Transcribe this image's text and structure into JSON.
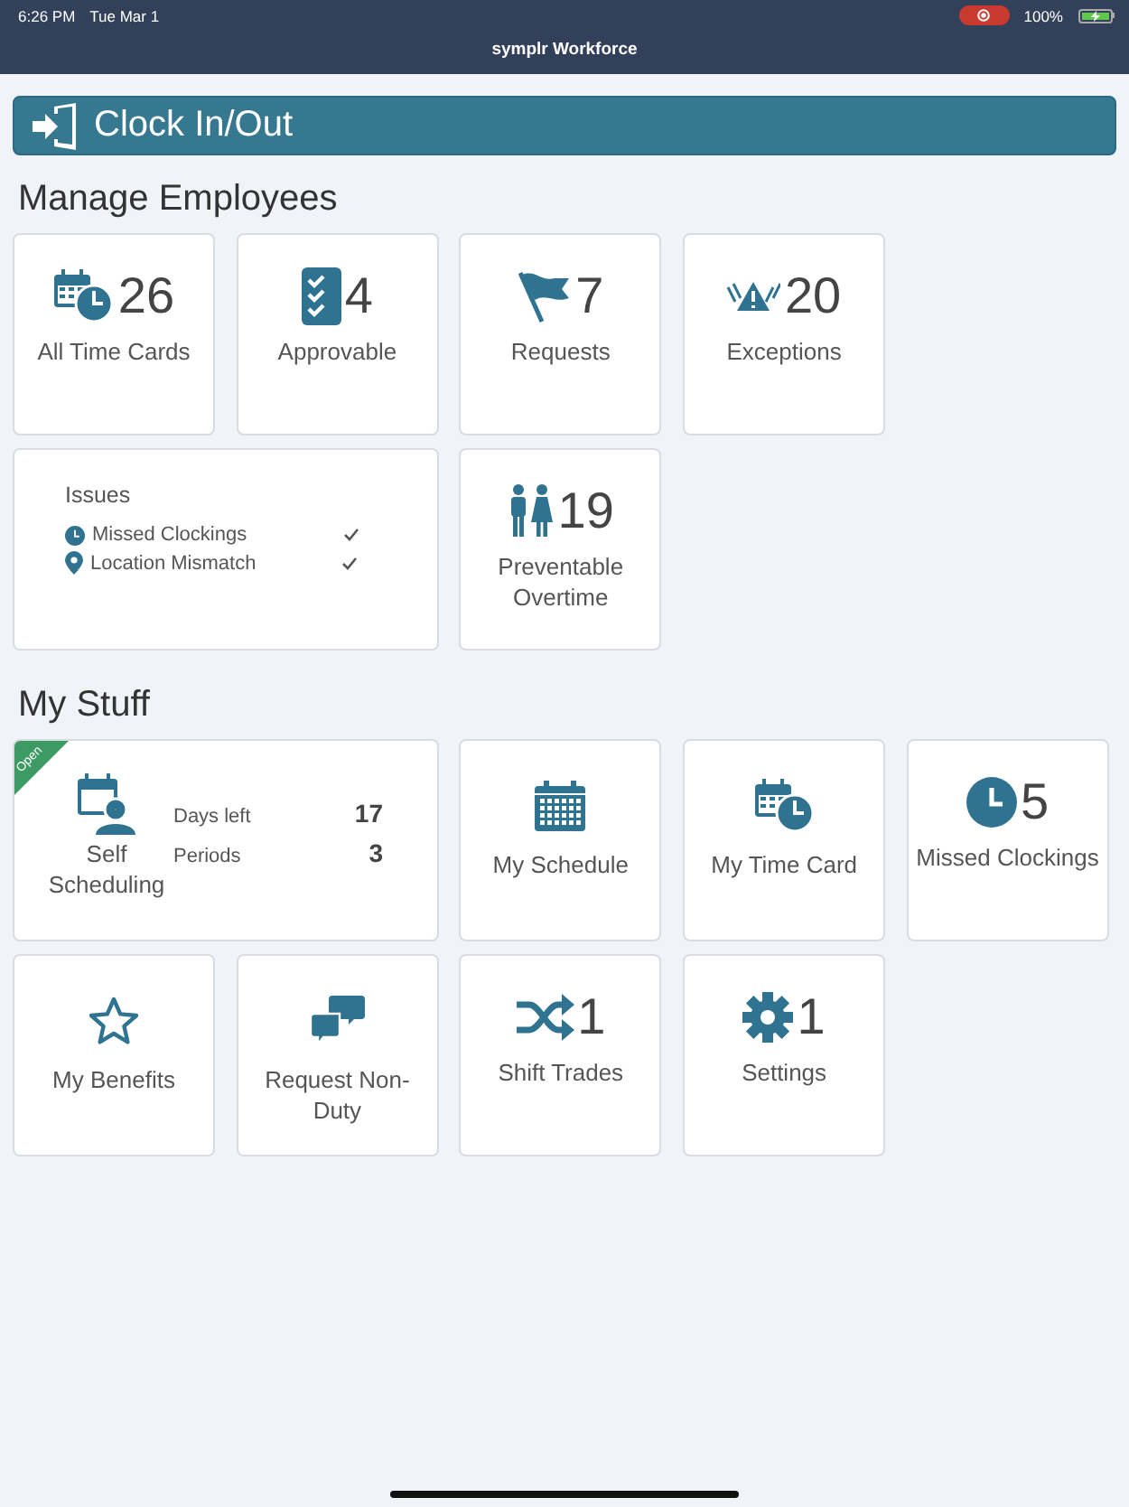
{
  "status_bar": {
    "time": "6:26 PM",
    "date": "Tue Mar 1",
    "recording": true,
    "battery_text": "100%",
    "battery": {
      "charging": true
    }
  },
  "window": {
    "title": "symplr Workforce"
  },
  "clock_button": {
    "label": "Clock In/Out"
  },
  "sections": [
    {
      "title": "Manage Employees",
      "tiles": [
        {
          "kind": "count",
          "count": "26",
          "label": "All Time Cards"
        },
        {
          "kind": "count",
          "count": "4",
          "label": "Approvable"
        },
        {
          "kind": "count",
          "count": "7",
          "label": "Requests"
        },
        {
          "kind": "count",
          "count": "20",
          "label": "Exceptions"
        },
        {
          "kind": "issues",
          "title": "Issues",
          "items": [
            {
              "label": "Missed Clockings",
              "checked": true
            },
            {
              "label": "Location Mismatch",
              "checked": true
            }
          ]
        },
        {
          "kind": "count",
          "count": "19",
          "label": "Preventable Overtime"
        }
      ]
    },
    {
      "title": "My Stuff",
      "tiles": [
        {
          "kind": "self_scheduling",
          "badge": "Open",
          "label": "Self Scheduling",
          "stats": [
            {
              "label": "Days left",
              "value": "17"
            },
            {
              "label": "Periods",
              "value": "3"
            }
          ]
        },
        {
          "kind": "label",
          "label": "My Schedule"
        },
        {
          "kind": "label",
          "label": "My Time Card"
        },
        {
          "kind": "count",
          "count": "5",
          "label": "Missed Clockings"
        },
        {
          "kind": "label",
          "label": "My Benefits"
        },
        {
          "kind": "label",
          "label": "Request Non-Duty"
        },
        {
          "kind": "count",
          "count": "1",
          "label": "Shift Trades"
        },
        {
          "kind": "count",
          "count": "1",
          "label": "Settings"
        }
      ]
    }
  ]
}
